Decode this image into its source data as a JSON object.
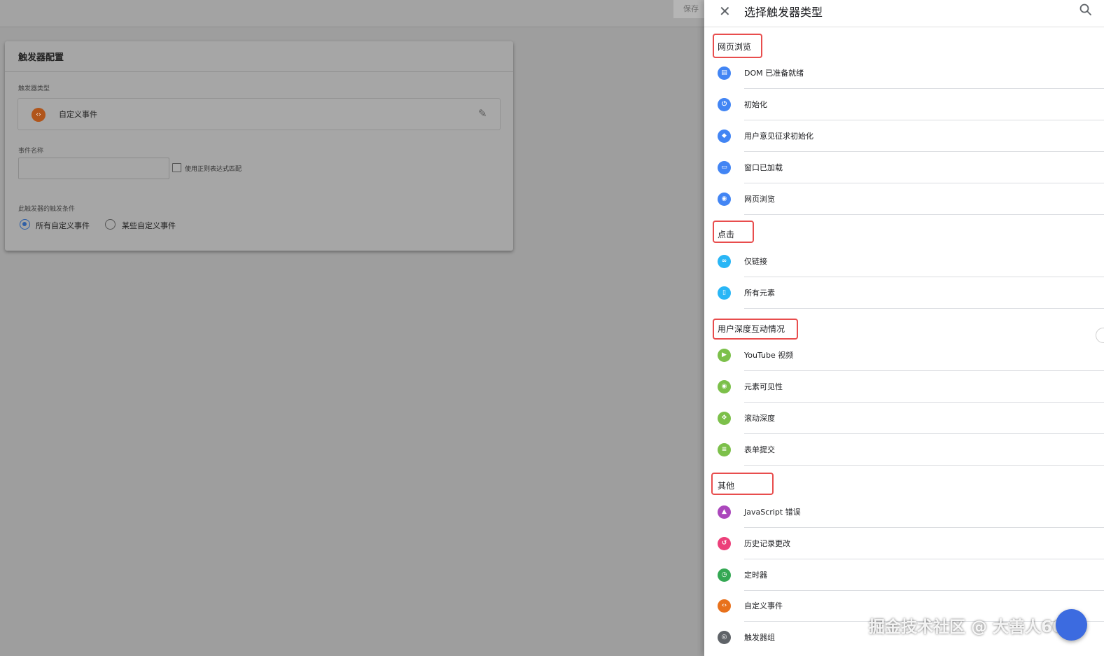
{
  "topbar": {
    "save_label": "保存"
  },
  "card": {
    "title": "触发器配置",
    "type_label": "触发器类型",
    "type_value": "自定义事件",
    "event_name_label": "事件名称",
    "event_name_value": "",
    "regex_label": "使用正则表达式匹配",
    "condition_label": "此触发器的触发条件",
    "radio_all": "所有自定义事件",
    "radio_some": "某些自定义事件"
  },
  "panel": {
    "title": "选择触发器类型",
    "sections": [
      {
        "label": "网页浏览",
        "items": [
          {
            "label": "DOM 已准备就绪",
            "icon": "document-icon",
            "color": "#4285f4"
          },
          {
            "label": "初始化",
            "icon": "power-icon",
            "color": "#4285f4"
          },
          {
            "label": "用户意见征求初始化",
            "icon": "shield-icon",
            "color": "#4285f4"
          },
          {
            "label": "窗口已加载",
            "icon": "window-icon",
            "color": "#4285f4"
          },
          {
            "label": "网页浏览",
            "icon": "eye-icon",
            "color": "#4285f4"
          }
        ]
      },
      {
        "label": "点击",
        "items": [
          {
            "label": "仅链接",
            "icon": "link-icon",
            "color": "#29b6f6"
          },
          {
            "label": "所有元素",
            "icon": "mouse-icon",
            "color": "#29b6f6"
          }
        ]
      },
      {
        "label": "用户深度互动情况",
        "items": [
          {
            "label": "YouTube 视频",
            "icon": "play-icon",
            "color": "#7cc04a"
          },
          {
            "label": "元素可见性",
            "icon": "eye-icon",
            "color": "#7cc04a"
          },
          {
            "label": "滚动深度",
            "icon": "scroll-icon",
            "color": "#7cc04a"
          },
          {
            "label": "表单提交",
            "icon": "form-icon",
            "color": "#7cc04a"
          }
        ]
      },
      {
        "label": "其他",
        "items": [
          {
            "label": "JavaScript 错误",
            "icon": "warning-icon",
            "color": "#ab47bc"
          },
          {
            "label": "历史记录更改",
            "icon": "history-icon",
            "color": "#ec407a"
          },
          {
            "label": "定时器",
            "icon": "alarm-icon",
            "color": "#34a853"
          },
          {
            "label": "自定义事件",
            "icon": "code-icon",
            "color": "#e8711c"
          },
          {
            "label": "触发器组",
            "icon": "group-icon",
            "color": "#5f6368"
          }
        ]
      }
    ]
  },
  "watermark": "掘金技术社区 @ 大善人666"
}
